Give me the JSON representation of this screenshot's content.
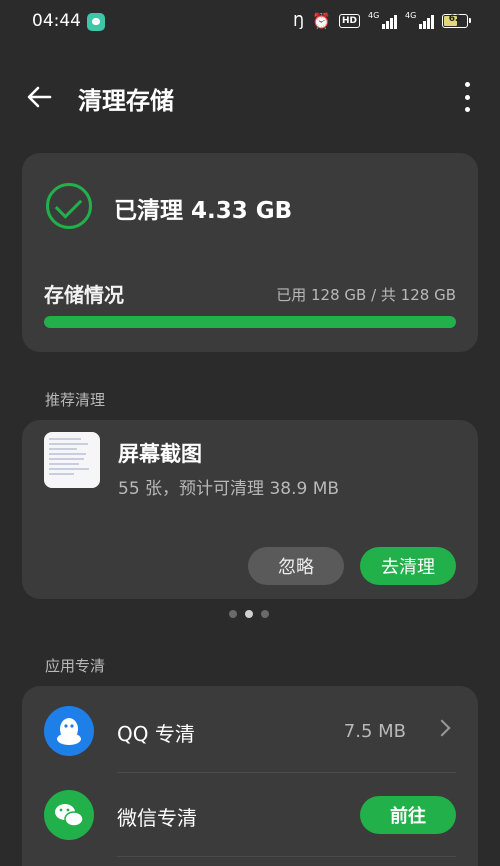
{
  "status_bar": {
    "time": "04:44",
    "signal_1_label": "4G",
    "signal_2_label": "4G",
    "hd_label": "HD",
    "battery_percent": 62,
    "battery_label": "62"
  },
  "header": {
    "title": "清理存储"
  },
  "summary": {
    "cleaned_text": "已清理 4.33 GB",
    "storage_label": "存储情况",
    "usage_text": "已用 128 GB / 共 128 GB",
    "usage_fraction": 1.0
  },
  "recommend": {
    "section_title": "推荐清理",
    "item_title": "屏幕截图",
    "item_subtitle": "55 张，预计可清理 38.9 MB",
    "ignore_label": "忽略",
    "clean_label": "去清理",
    "pager_count": 3,
    "pager_active": 1
  },
  "apps": {
    "section_title": "应用专清",
    "items": [
      {
        "name": "QQ 专清",
        "size": "7.5 MB",
        "icon": "qq-penguin-icon"
      },
      {
        "name": "微信专清",
        "action_label": "前往",
        "icon": "wechat-bubbles-icon"
      }
    ]
  },
  "colors": {
    "accent_green": "#22b04a",
    "qq_blue": "#1f7fe8",
    "background": "#2b2b2b",
    "card": "#3b3b3b"
  }
}
